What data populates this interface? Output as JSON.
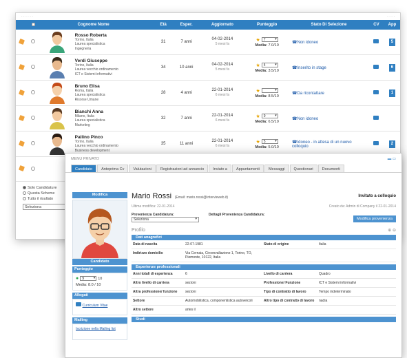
{
  "list": {
    "headers": [
      "Cognome Nome",
      "Età",
      "Esper.",
      "Aggiornato",
      "Punteggio",
      "Stato Di Selezione",
      "CV",
      "App"
    ],
    "rows": [
      {
        "name": "Rosso Roberta",
        "l1": "Torino, Italia",
        "l2": "Laurea specialistica",
        "l3": "Ingegneria",
        "eta": "31",
        "esp": "7 anni",
        "date": "04-02-2014",
        "ago": "5 mesi fa",
        "score": "7",
        "media": "7.0/10",
        "stato": "Non idoneo",
        "app": "5"
      },
      {
        "name": "Verdi Giuseppe",
        "l1": "Torino, Italia",
        "l2": "Laurea vecchio ordinamento",
        "l3": "ICT e Sistemi informativi",
        "eta": "34",
        "esp": "10 anni",
        "date": "04-02-2014",
        "ago": "5 mesi fa",
        "score": "4",
        "media": "3.5/10",
        "stato": "Inserito in stage",
        "app": "6"
      },
      {
        "name": "Bruno Elisa",
        "l1": "Roma, Italia",
        "l2": "Laurea specialistica",
        "l3": "Risorse Umane",
        "eta": "28",
        "esp": "4 anni",
        "date": "22-01-2014",
        "ago": "6 mesi fa",
        "score": "",
        "media": "8.5/10",
        "stato": "Da ricontattare",
        "app": "1"
      },
      {
        "name": "Bianchi Anna",
        "l1": "Milano, Italia",
        "l2": "Laurea specialistica",
        "l3": "Marketing",
        "eta": "32",
        "esp": "7 anni",
        "date": "22-01-2014",
        "ago": "6 mesi fa",
        "score": "9",
        "media": "6.5/10",
        "stato": "Non idoneo",
        "app": ""
      },
      {
        "name": "Pallino Pinco",
        "l1": "Torino, Italia",
        "l2": "Laurea vecchio ordinamento",
        "l3": "Business development",
        "eta": "35",
        "esp": "11 anni",
        "date": "22-01-2014",
        "ago": "6 mesi fa",
        "score": "5",
        "media": "5.0/10",
        "stato": "Idoneo - in attesa di un nuovo colloquio",
        "app": "2"
      }
    ],
    "radio": [
      "Solo Candidature",
      "Questa Scheme",
      "Tutto il risultato"
    ],
    "select_value": "Seleziona"
  },
  "detail": {
    "breadcrumb": "MENU PRIVATO",
    "tabs": [
      "Candidato",
      "Anteprima Cv",
      "Valutazioni",
      "Registrazioni ad annuncio",
      "Inviato a",
      "Appuntamenti",
      "Messaggi",
      "Questionari",
      "Documenti"
    ],
    "name": "Mario Rossi",
    "email": "(Email: mario.rossi@intervieweb.it)",
    "invite": "Invitato a colloquio",
    "last_mod": "Ultima modifica: 22-01-2014",
    "created": "Creato da: Admin di Company il 22-01-2014",
    "prov_label": "Provenienza Candidatura:",
    "prov_value": "Seleziona",
    "prov_detail_label": "Dettagli Provenienza Candidatura:",
    "prov_button": "Modifica provenienza",
    "profilo": "Profilo",
    "left": {
      "modifica": "Modifica",
      "candidato": "Candidato",
      "punteggio": "Punteggio",
      "score": "9",
      "score_max": "10",
      "media": "Media: 8.0 / 10",
      "allegati": "Allegati",
      "cv": "Curriculum Vitae",
      "mailing": "Mailing",
      "mailing_link": "Iscrizione nella Mailing list"
    },
    "sections": {
      "anag": "Dati anagrafici",
      "exp": "Esperienze professionali",
      "studi": "Studi"
    },
    "anag_rows": [
      [
        "Data di nascita",
        "22-07-1981",
        "Stato di origine",
        "Italia"
      ],
      [
        "Indirizzo domicilio",
        "Via Cernaia, Circonvallazione 1, Torino, TO, Piemonte, 10122, Italia",
        "",
        ""
      ]
    ],
    "exp_rows": [
      [
        "Anni totali di esperienza",
        "6",
        "Livello di carriera",
        "Quadro"
      ],
      [
        "Altro livello di carriera",
        "sezioni",
        "Professione/ Funzione",
        "ICT e Sistemi informativi"
      ],
      [
        "Altra professione/ funzione",
        "sezioni",
        "Tipo di contratto di lavoro",
        "Tempo indeterminato"
      ],
      [
        "Settore",
        "Automobilistica, componentistica autoveicoli",
        "Altro tipo di contratto di lavoro",
        "nadia"
      ],
      [
        "Altro settore",
        "artes il",
        "",
        ""
      ]
    ]
  }
}
